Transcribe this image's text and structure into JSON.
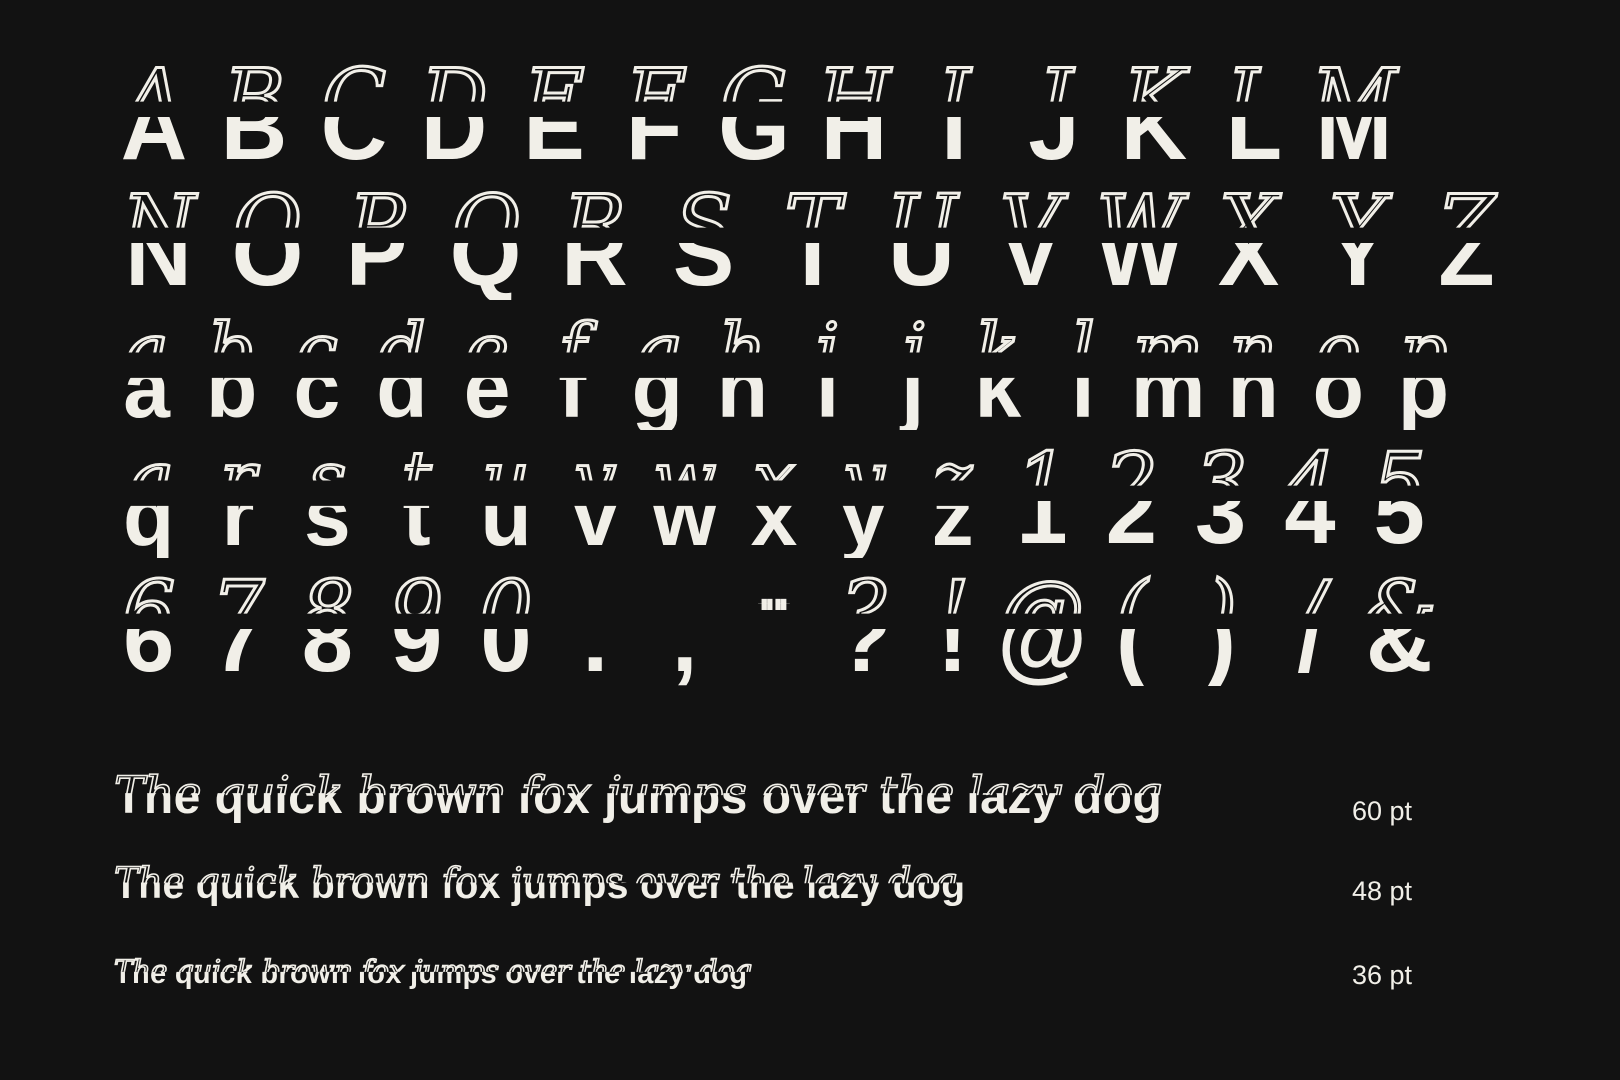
{
  "colors": {
    "background": "#121212",
    "foreground": "#f1efe8"
  },
  "glyph_rows": [
    [
      "A",
      "B",
      "C",
      "D",
      "E",
      "F",
      "G",
      "H",
      "I",
      "J",
      "K",
      "L",
      "M"
    ],
    [
      "N",
      "O",
      "P",
      "Q",
      "R",
      "S",
      "T",
      "U",
      "V",
      "W",
      "X",
      "Y",
      "Z"
    ],
    [
      "a",
      "b",
      "c",
      "d",
      "e",
      "f",
      "g",
      "h",
      "i",
      "j",
      "k",
      "l",
      "m",
      "n",
      "o",
      "p"
    ],
    [
      "q",
      "r",
      "s",
      "t",
      "u",
      "v",
      "w",
      "x",
      "y",
      "z",
      "1",
      "2",
      "3",
      "4",
      "5"
    ],
    [
      "6",
      "7",
      "8",
      "9",
      "0",
      ".",
      ",",
      "\"\"",
      "?",
      "!",
      "@",
      "(",
      ")",
      "/",
      "&"
    ]
  ],
  "pangrams": [
    {
      "text": "The quick brown fox jumps over the lazy dog",
      "size_label": "60 pt"
    },
    {
      "text": "The quick brown fox jumps over the lazy dog",
      "size_label": "48 pt"
    },
    {
      "text": "The quick brown fox jumps over the lazy dog",
      "size_label": "36 pt"
    }
  ]
}
